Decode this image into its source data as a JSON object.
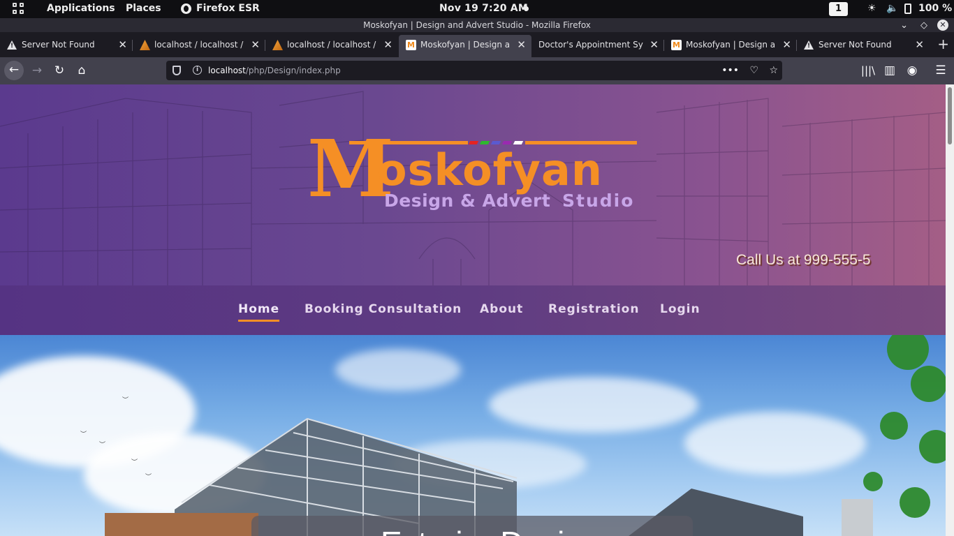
{
  "topbar": {
    "applications": "Applications",
    "places": "Places",
    "app_name": "Firefox ESR",
    "clock": "Nov 19   7:20 AM",
    "workspace": "1",
    "battery": "100 %"
  },
  "window": {
    "title": "Moskofyan | Design and Advert Studio - Mozilla Firefox"
  },
  "tabs": [
    {
      "label": "Server Not Found",
      "icon": "warning-icon"
    },
    {
      "label": "localhost / localhost / doc",
      "icon": "phpmyadmin-icon"
    },
    {
      "label": "localhost / localhost / cdf",
      "icon": "phpmyadmin-icon"
    },
    {
      "label": "Moskofyan | Design and A",
      "icon": "moskofyan-favicon"
    },
    {
      "label": "Doctor's Appointment System",
      "icon": ""
    },
    {
      "label": "Moskofyan | Design and A",
      "icon": "moskofyan-favicon"
    },
    {
      "label": "Server Not Found",
      "icon": "warning-icon"
    }
  ],
  "active_tab": 3,
  "urlbar": {
    "host": "localhost",
    "path": "/php/Design/index.php"
  },
  "site": {
    "logo": {
      "letter": "M",
      "word": "oskofyan",
      "subtitle": "Design & Advert",
      "subtitle2": "Studio"
    },
    "call_us": "Call Us at 999-555-5",
    "menu": [
      {
        "label": "Home",
        "active": true
      },
      {
        "label": "Booking Consultation",
        "active": false
      },
      {
        "label": "About",
        "active": false
      },
      {
        "label": "Registration",
        "active": false
      },
      {
        "label": "Login",
        "active": false
      }
    ],
    "hero_caption": "Exterior Design"
  },
  "colors": {
    "accent": "#f58f25",
    "header_purple": "#5b3a8e",
    "sub_lilac": "#c8a6e8"
  }
}
